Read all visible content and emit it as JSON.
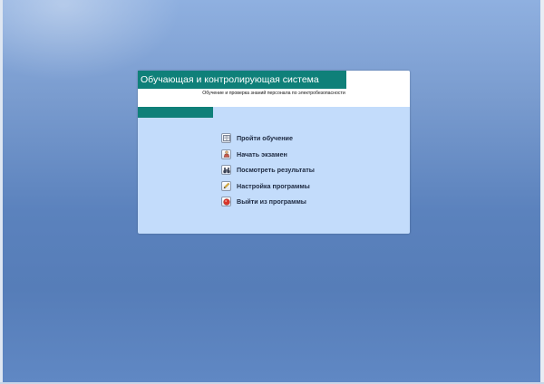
{
  "window": {
    "title": "Обучающая и контролирующая система",
    "subtitle": "Обучение и проверка знаний персонала по электробезопасности"
  },
  "menu": {
    "items": [
      {
        "label": "Пройти обучение",
        "icon": "book-icon"
      },
      {
        "label": "Начать экзамен",
        "icon": "exam-icon"
      },
      {
        "label": "Посмотреть результаты",
        "icon": "binoculars-icon"
      },
      {
        "label": "Настройка программы",
        "icon": "pencil-icon"
      },
      {
        "label": "Выйти из программы",
        "icon": "exit-icon"
      }
    ]
  },
  "colors": {
    "accent": "#0f8079",
    "panel_background": "#c3dcfb",
    "desktop_background": "#5f86bf",
    "exit_icon": "#d9352a"
  }
}
